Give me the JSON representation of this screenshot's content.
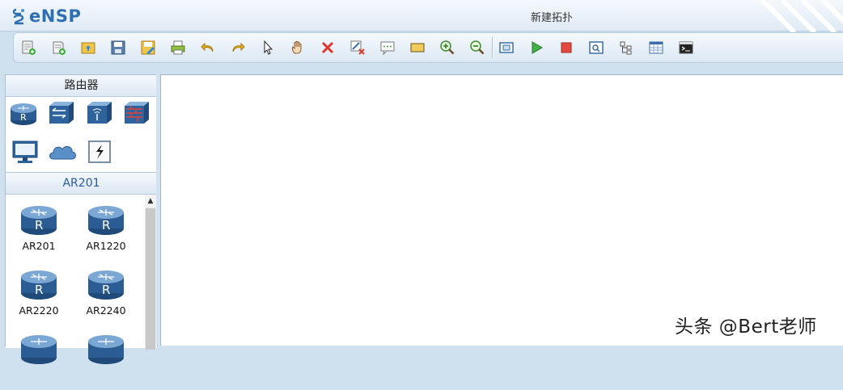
{
  "app": {
    "logo_text": "eNSP",
    "window_title": "新建拓扑"
  },
  "toolbar": {
    "buttons": [
      "new-topology-icon",
      "new-lab-icon",
      "open-icon",
      "save-icon",
      "save-as-icon",
      "print-icon",
      "undo-icon",
      "redo-icon",
      "select-icon",
      "pan-hand-icon",
      "delete-icon",
      "delete-links-icon",
      "text-note-icon",
      "rectangle-icon",
      "zoom-in-icon",
      "zoom-out-icon",
      "fit-icon",
      "start-device-icon",
      "stop-device-icon",
      "capture-icon",
      "topology-tree-icon",
      "grid-icon",
      "terminal-icon"
    ]
  },
  "left_panel": {
    "category_header": "路由器",
    "categories": [
      "router-icon",
      "switch-icon",
      "wireless-icon",
      "firewall-icon",
      "pc-icon",
      "cloud-icon",
      "link-icon"
    ],
    "device_header": "AR201",
    "devices": [
      {
        "label": "AR201"
      },
      {
        "label": "AR1220"
      },
      {
        "label": "AR2220"
      },
      {
        "label": "AR2240"
      },
      {
        "label": ""
      },
      {
        "label": ""
      }
    ]
  },
  "watermark": "头条 @Bert老师",
  "colors": {
    "accent": "#2d6fb1",
    "panel_header": "#dce8f4",
    "canvas": "#ffffff"
  }
}
